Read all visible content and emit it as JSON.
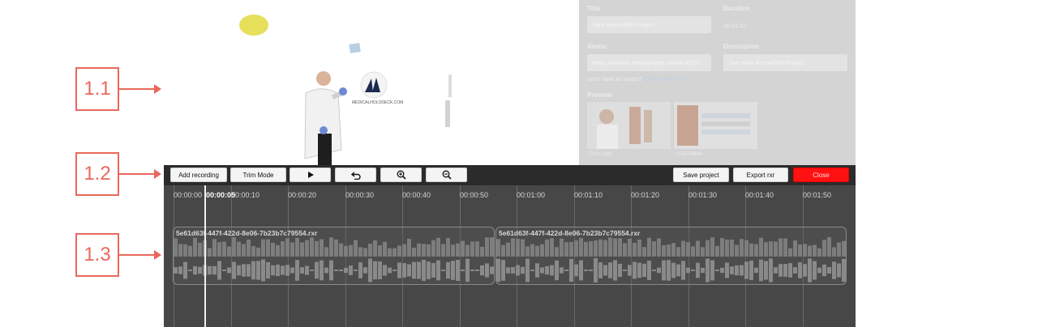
{
  "callouts": [
    "1.1",
    "1.2",
    "1.3"
  ],
  "details": {
    "title_label": "Title",
    "title_value": "New RecordXR Project",
    "duration_label": "Duration",
    "duration_value": "00:01:57",
    "avatar_label": "Avatar",
    "avatar_value": "https://models.readyplayer.me/6418527",
    "description_label": "Description",
    "description_value": "See New RecordXR Project",
    "avatar_hint": "Don't have an avatar?",
    "avatar_hint_link": "Create one here",
    "preview_label": "Preview",
    "previews": [
      {
        "caption": "720×1280"
      },
      {
        "caption": "2160×3840"
      }
    ]
  },
  "viewport": {
    "logo_text": "MEDICALHOLODECK.COM"
  },
  "toolbar": {
    "add_recording": "Add recording",
    "trim_mode": "Trim Mode",
    "play_icon": "play-icon",
    "undo_icon": "undo-icon",
    "zoom_in_icon": "zoom-in-icon",
    "zoom_out_icon": "zoom-out-icon",
    "save_project": "Save project",
    "export_rxr": "Export rxr",
    "close": "Close",
    "close_color": "#ff1111"
  },
  "timeline": {
    "playhead_time": "00:00:05",
    "ticks": [
      "00:00:00",
      "00:00:10",
      "00:00:20",
      "00:00:30",
      "00:00:40",
      "00:00:50",
      "00:01:00",
      "00:01:10",
      "00:01:20",
      "00:01:30",
      "00:01:40",
      "00:01:50"
    ],
    "clips": [
      {
        "name": "5e61d63f-447f-422d-8e06-7b23b7c79554.rxr"
      },
      {
        "name": "5e61d63f-447f-422d-8e06-7b23b7c79554.rxr"
      }
    ]
  }
}
